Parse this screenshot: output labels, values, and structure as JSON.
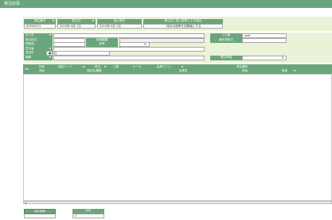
{
  "window": {
    "title": "発注伝票"
  },
  "header": {
    "order_no_label": "発注番号",
    "order_date_label": "発注日",
    "delivery_date_label": "納入期日",
    "notice_label": "発注日と違う税率にする場合",
    "order_no": "00000001",
    "order_date": "2019年 9月 1日",
    "delivery_date": "2019年 9月 1日",
    "notice_value": "時点の税率を初期値にする"
  },
  "supplier": {
    "name_label": "仕入先",
    "manager_label": "取引担当",
    "tax_label": "税転換",
    "tax_type_label": "単価種類",
    "rate_label": "掛率",
    "rate_unit": "%",
    "dept_label": "担当者",
    "dest_label": "発送先",
    "dest_value": "●会社",
    "memo_label": "摘要",
    "inputter_label": "入力者",
    "inputter_value": "wait",
    "last_update_label": "最終更新日",
    "balance_label": "発注残高",
    "balance_value": "0"
  },
  "grid": {
    "no_label": "No.",
    "inner_label": "内訳",
    "goods_label": "商品",
    "code_label": "商品コード",
    "name_label": "商品名/摘要",
    "unit_label": "単位",
    "qty_in_label": "入数",
    "case_label": "ケース",
    "warehouse_code_label": "倉庫コード",
    "warehouse_name_label": "倉庫名",
    "order_type_label": "発注種別",
    "quantity_label": "数量",
    "price_label": "単価",
    "amount_label": "金額"
  },
  "footer": {
    "tax_update_label": "消込更新",
    "total_label": "合計",
    "total_value": "0"
  },
  "colors": {
    "accent": "#6aa57c",
    "band": "#eaf2d8"
  }
}
